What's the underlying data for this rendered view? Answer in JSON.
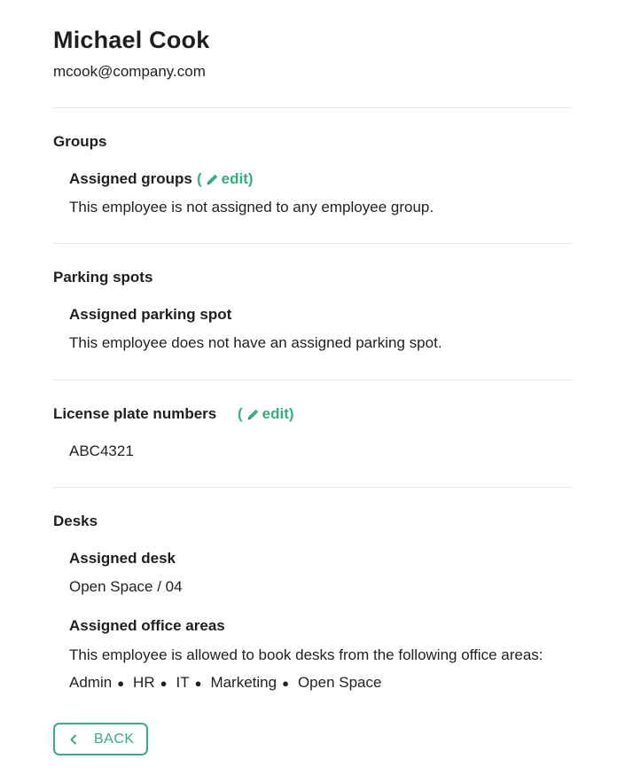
{
  "employee": {
    "name": "Michael Cook",
    "email": "mcook@company.com"
  },
  "groups": {
    "title": "Groups",
    "assigned_label": "Assigned groups",
    "edit_label": "edit",
    "empty_text": "This employee is not assigned to any employee group."
  },
  "parking": {
    "title": "Parking spots",
    "assigned_label": "Assigned parking spot",
    "empty_text": "This employee does not have an assigned parking spot."
  },
  "license": {
    "title": "License plate numbers",
    "edit_label": "edit",
    "plates": [
      "ABC4321"
    ]
  },
  "desks": {
    "title": "Desks",
    "assigned_desk_label": "Assigned desk",
    "assigned_desk_value": "Open Space / 04",
    "areas_label": "Assigned office areas",
    "areas_intro": "This employee is allowed to book desks from the following office areas:",
    "areas": [
      "Admin",
      "HR",
      "IT",
      "Marketing",
      "Open Space"
    ]
  },
  "back_button": {
    "label": "BACK",
    "icon": "chevron-left-icon"
  },
  "colors": {
    "accent": "#3aac7e",
    "text": "#222222",
    "divider": "#e6e6e6"
  }
}
